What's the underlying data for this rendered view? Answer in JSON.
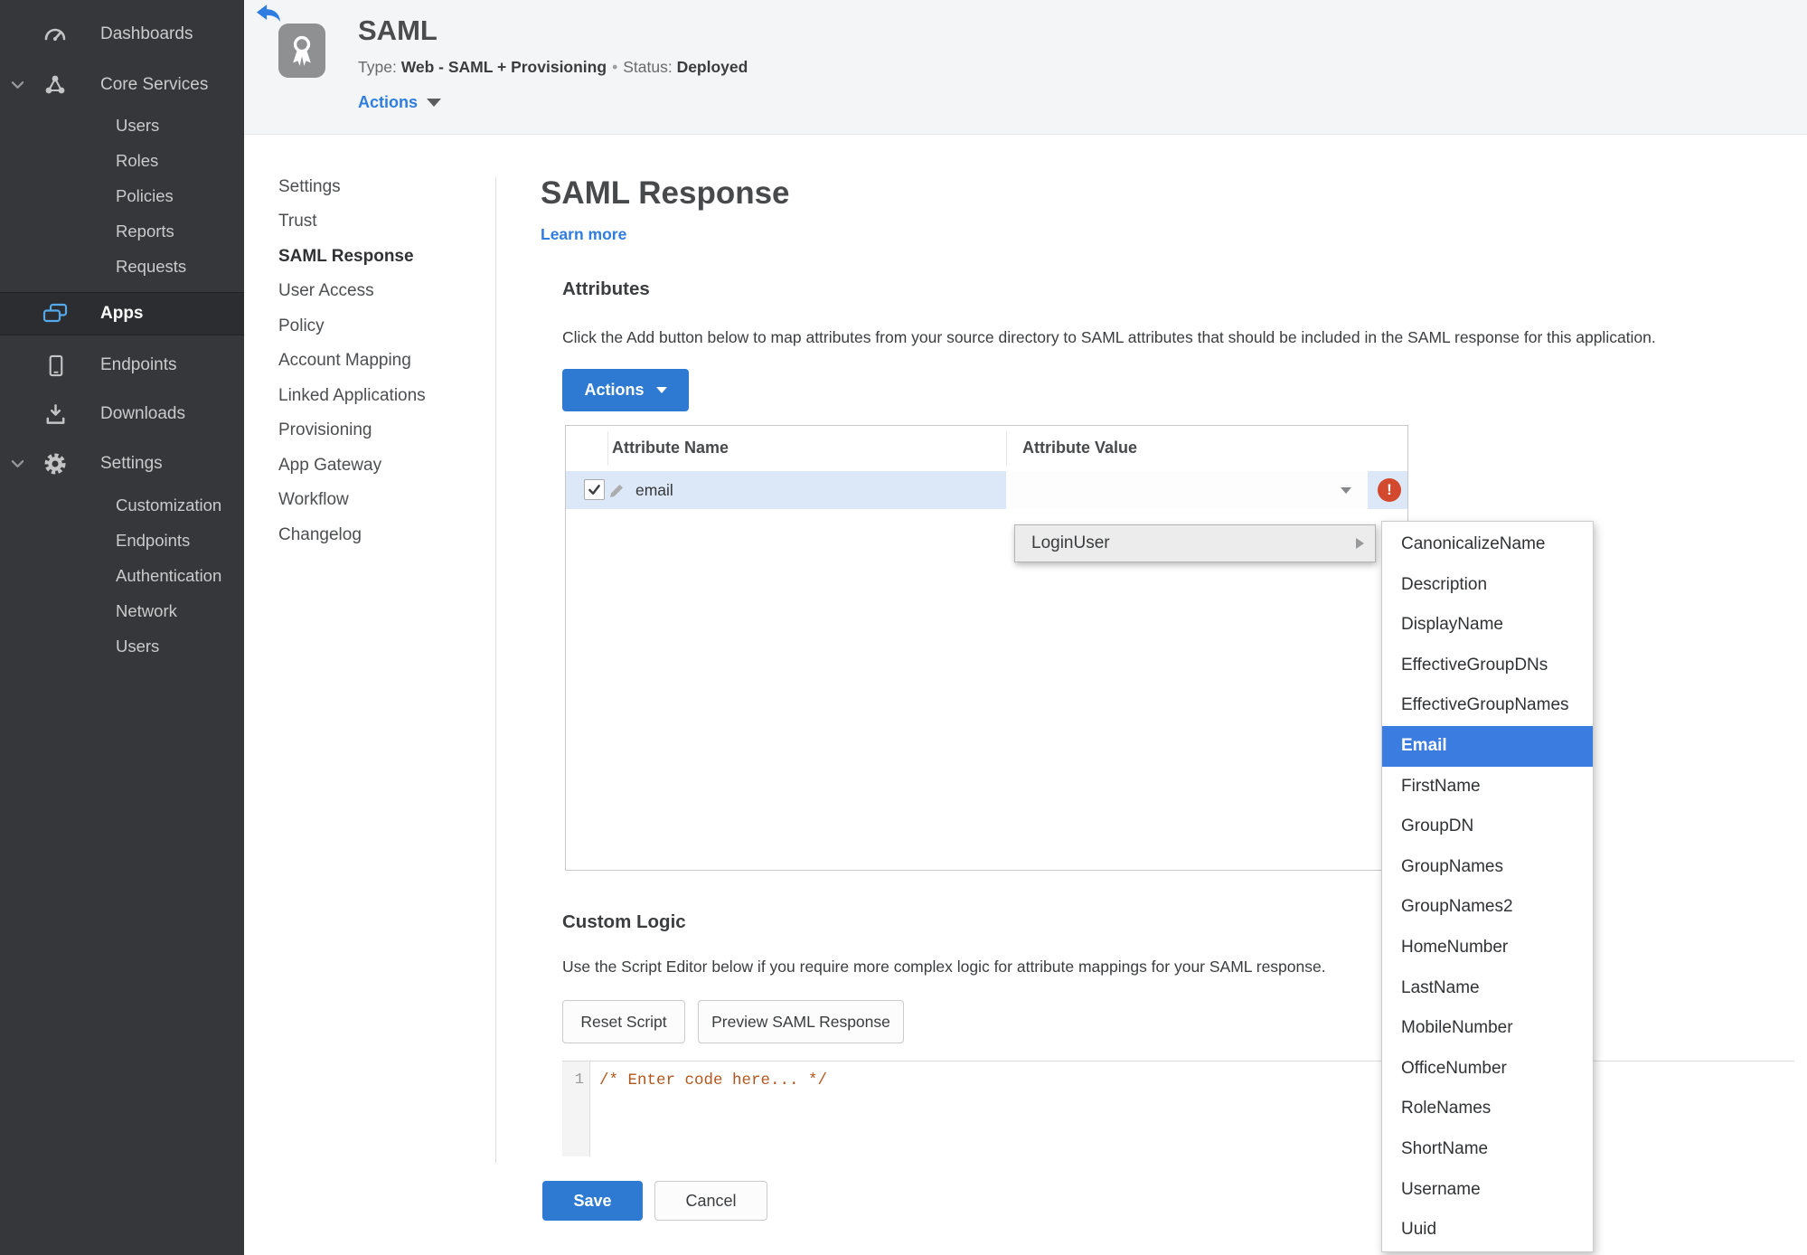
{
  "sidebar": {
    "items": [
      {
        "label": "Dashboards"
      },
      {
        "label": "Core Services"
      },
      {
        "label": "Users"
      },
      {
        "label": "Roles"
      },
      {
        "label": "Policies"
      },
      {
        "label": "Reports"
      },
      {
        "label": "Requests"
      },
      {
        "label": "Apps"
      },
      {
        "label": "Endpoints"
      },
      {
        "label": "Downloads"
      },
      {
        "label": "Settings"
      },
      {
        "label": "Customization"
      },
      {
        "label": "Endpoints"
      },
      {
        "label": "Authentication"
      },
      {
        "label": "Network"
      },
      {
        "label": "Users"
      }
    ]
  },
  "header": {
    "app_title": "SAML",
    "type_label": "Type:",
    "type_value": "Web - SAML + Provisioning",
    "separator": "•",
    "status_label": "Status:",
    "status_value": "Deployed",
    "actions_label": "Actions"
  },
  "subnav": {
    "items": [
      {
        "label": "Settings"
      },
      {
        "label": "Trust"
      },
      {
        "label": "SAML Response"
      },
      {
        "label": "User Access"
      },
      {
        "label": "Policy"
      },
      {
        "label": "Account Mapping"
      },
      {
        "label": "Linked Applications"
      },
      {
        "label": "Provisioning"
      },
      {
        "label": "App Gateway"
      },
      {
        "label": "Workflow"
      },
      {
        "label": "Changelog"
      }
    ],
    "active": "SAML Response"
  },
  "main": {
    "title": "SAML Response",
    "learn_more": "Learn more",
    "attributes": {
      "heading": "Attributes",
      "description": "Click the Add button below to map attributes from your source directory to SAML attributes that should be included in the SAML response for this application.",
      "actions_button": "Actions",
      "table": {
        "columns": [
          "Attribute Name",
          "Attribute Value"
        ],
        "rows": [
          {
            "name": "email",
            "value": "",
            "checked": true,
            "error": true
          }
        ]
      }
    },
    "custom_logic": {
      "heading": "Custom Logic",
      "description": "Use the Script Editor below if you require more complex logic for attribute mappings for your SAML response.",
      "reset_button": "Reset Script",
      "preview_button": "Preview SAML Response",
      "editor": {
        "line_number": "1",
        "code": "/* Enter code here... */"
      }
    },
    "save_button": "Save",
    "cancel_button": "Cancel"
  },
  "dropdown": {
    "parent_item": "LoginUser",
    "selected_option": "Email",
    "options": [
      "CanonicalizeName",
      "Description",
      "DisplayName",
      "EffectiveGroupDNs",
      "EffectiveGroupNames",
      "Email",
      "FirstName",
      "GroupDN",
      "GroupNames",
      "GroupNames2",
      "HomeNumber",
      "LastName",
      "MobileNumber",
      "OfficeNumber",
      "RoleNames",
      "ShortName",
      "Username",
      "Uuid"
    ]
  },
  "icons": {
    "gauge-icon": "speedometer",
    "core-services-icon": "node-cluster",
    "apps-icon": "layered-windows",
    "endpoints-icon": "mobile-device",
    "downloads-icon": "download-arrow",
    "gear-icon": "gear",
    "chevron-down-icon": "chevron-down",
    "back-icon": "back-arrow",
    "award-icon": "ribbon-badge",
    "pencil-icon": "edit-pencil",
    "check-icon": "checkmark",
    "error-icon": "exclamation-circle"
  },
  "colors": {
    "accent_blue": "#2e7ad3",
    "status_green": "#41872a",
    "error_red": "#d2492e",
    "row_highlight": "#dce8f7",
    "sidebar_bg": "#35373a"
  }
}
